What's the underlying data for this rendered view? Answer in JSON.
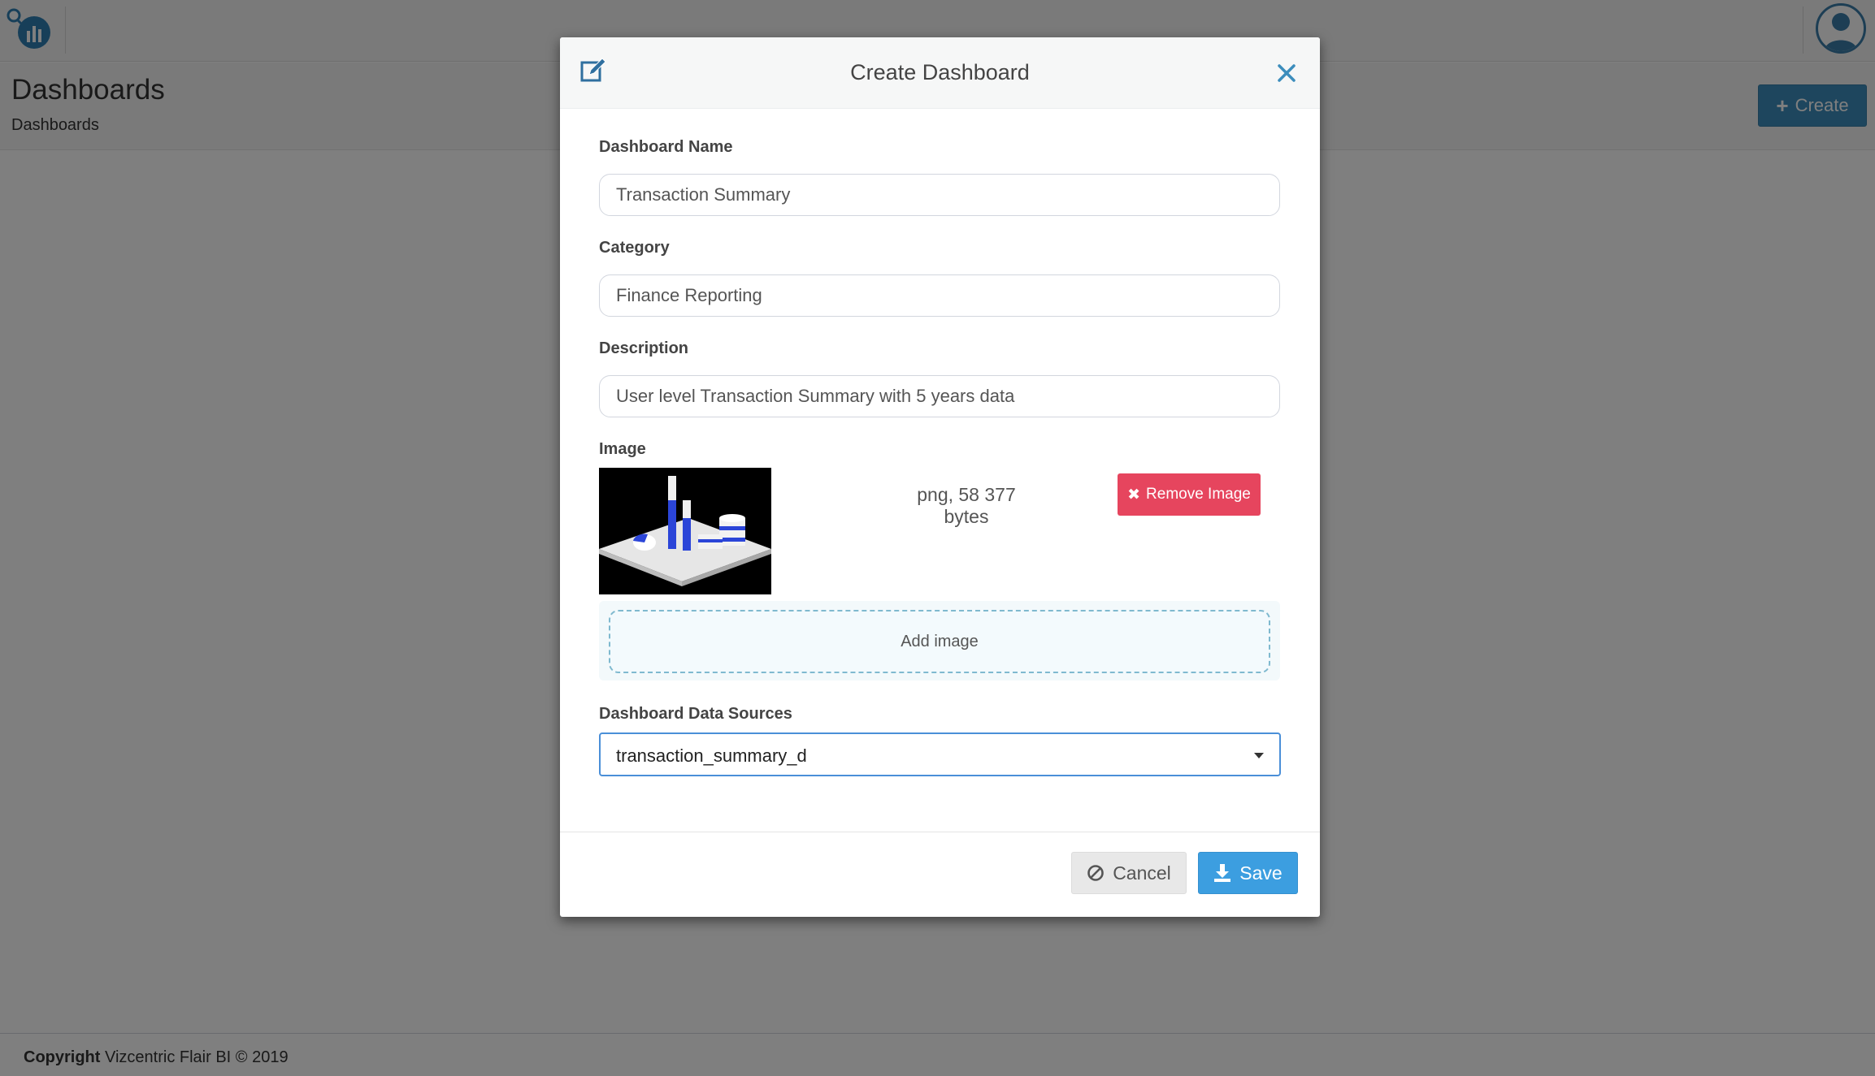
{
  "app": {
    "page_title": "Dashboards",
    "breadcrumb": "Dashboards",
    "create_label": "Create",
    "footer_bold": "Copyright",
    "footer_text": " Vizcentric Flair BI © 2019",
    "accent": "#3c8dbc"
  },
  "modal": {
    "title": "Create Dashboard",
    "fields": {
      "name_label": "Dashboard Name",
      "name_value": "Transaction Summary",
      "category_label": "Category",
      "category_value": "Finance Reporting",
      "description_label": "Description",
      "description_value": "User level Transaction Summary with 5 years data",
      "image_label": "Image",
      "image_info": "png, 58 377 bytes",
      "remove_image_label": "Remove Image",
      "add_image_label": "Add image",
      "datasources_label": "Dashboard Data Sources",
      "datasource_selected": "transaction_summary_d"
    },
    "buttons": {
      "cancel": "Cancel",
      "save": "Save"
    },
    "colors": {
      "remove": "#e6455e",
      "save": "#3c9ee0",
      "close": "#3c8dbc"
    }
  },
  "icons": [
    "logo-icon",
    "user-avatar-icon",
    "plus-icon",
    "edit-icon",
    "close-icon",
    "times-icon",
    "ban-icon",
    "download-icon",
    "caret-down-icon"
  ]
}
